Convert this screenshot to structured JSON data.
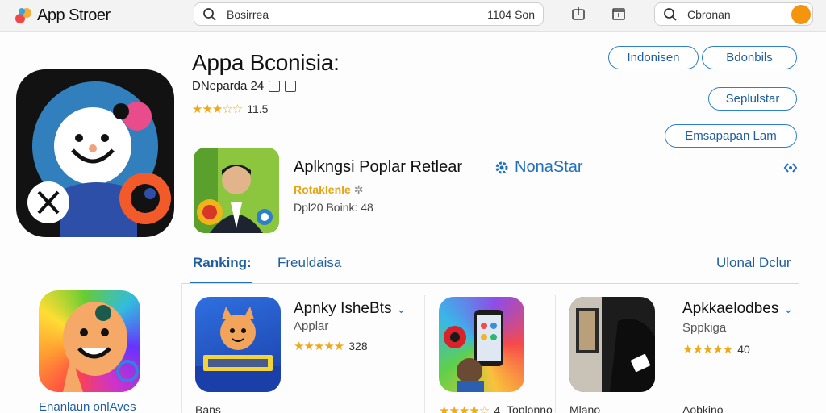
{
  "topbar": {
    "logo_text": "App Stroer",
    "search_placeholder": "Bosirrea",
    "search_right": "1104 Son",
    "search2_placeholder": "Cbronan"
  },
  "app": {
    "title": "Appa Bconisia:",
    "meta": "DNeparda 24",
    "stars": "★★★☆☆",
    "rating": "11.5"
  },
  "buttons": {
    "primary1": "Indonisen",
    "primary2": "Bdonbils",
    "secondary": "Seplulstar",
    "tertiary": "Emsapapan Lam"
  },
  "featured": {
    "title": "Aplkngsi Poplar Retlear",
    "badge": "NonaStar",
    "subtitle": "Rotaklenle",
    "detail": "Dpl20 Boink: 48"
  },
  "tabs": {
    "ranking": "Ranking:",
    "second": "Freuldaisa",
    "right": "Ulonal Dclur"
  },
  "side": {
    "label": "Enanlaun onlAves"
  },
  "cards": [
    {
      "title": "Apnky IsheBts",
      "sub": "Applar",
      "stars": "★★★★★",
      "rating": "328",
      "bottom": "Bans"
    },
    {
      "title": "",
      "sub": "",
      "stars": "★★★★☆",
      "rating": "4",
      "bottom": "Toplonno"
    },
    {
      "title": "Apkkaelodbes",
      "sub": "Sppkiga",
      "stars": "★★★★★",
      "rating": "40",
      "bottom": "Mlano"
    }
  ],
  "bottom_right": "Aobkino",
  "colors": {
    "accent": "#1f6fc0",
    "star": "#f0a81a",
    "orange": "#f5940f"
  }
}
